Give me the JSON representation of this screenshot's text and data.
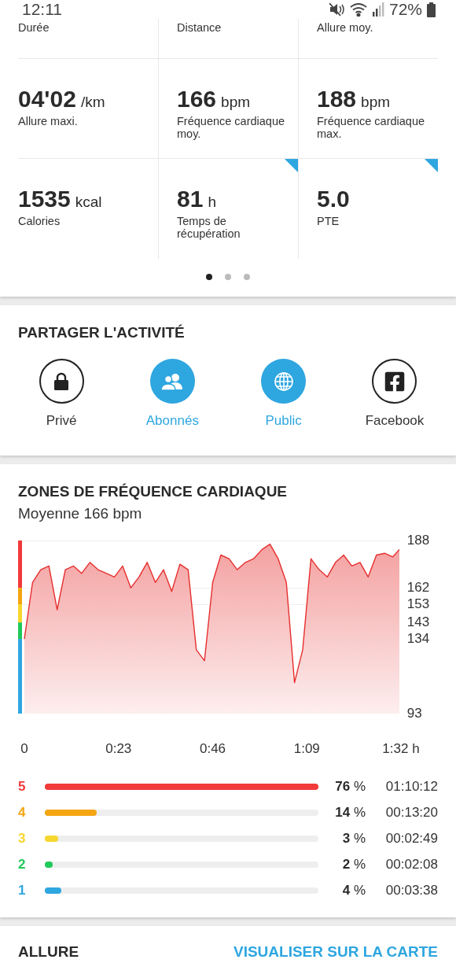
{
  "status_bar": {
    "time": "12:11",
    "battery": "72%"
  },
  "stats": {
    "rows": [
      [
        {
          "label": "Durée",
          "flagged": false
        },
        {
          "label": "Distance",
          "flagged": false
        },
        {
          "label": "Allure moy.",
          "flagged": false
        }
      ],
      [
        {
          "value": "04'02",
          "unit": "/km",
          "label": "Allure maxi.",
          "flagged": false
        },
        {
          "value": "166",
          "unit": "bpm",
          "label": "Fréquence cardiaque moy.",
          "flagged": false
        },
        {
          "value": "188",
          "unit": "bpm",
          "label": "Fréquence cardiaque max.",
          "flagged": false
        }
      ],
      [
        {
          "value": "1535",
          "unit": "kcal",
          "label": "Calories",
          "flagged": false
        },
        {
          "value": "81",
          "unit": "h",
          "label": "Temps de récupération",
          "flagged": true
        },
        {
          "value": "5.0",
          "label": "PTE",
          "flagged": true
        }
      ]
    ],
    "pages": [
      {
        "selected": true
      },
      {
        "selected": false
      },
      {
        "selected": false
      }
    ]
  },
  "share": {
    "title": "PARTAGER L'ACTIVITÉ",
    "options": [
      {
        "kind": "lock",
        "label": "Privé",
        "selected": false
      },
      {
        "kind": "people",
        "label": "Abonnés",
        "selected": true
      },
      {
        "kind": "globe",
        "label": "Public",
        "selected": true
      },
      {
        "kind": "facebook",
        "label": "Facebook",
        "selected": false
      }
    ]
  },
  "heart_rate": {
    "title": "ZONES DE FRÉQUENCE CARDIAQUE",
    "subtitle": "Moyenne 166 bpm",
    "chart_data": {
      "type": "area",
      "x": [
        0,
        2,
        4,
        6,
        8,
        10,
        12,
        14,
        16,
        18,
        20,
        22,
        24,
        26,
        28,
        30,
        32,
        34,
        36,
        38,
        40,
        42,
        44,
        46,
        48,
        50,
        52,
        54,
        56,
        58,
        60,
        62,
        64,
        66,
        68,
        70,
        72,
        74,
        76,
        78,
        80,
        82,
        84,
        86,
        88,
        90,
        92
      ],
      "series": [
        {
          "color": "#e62e2e",
          "values": [
            134,
            165,
            172,
            174,
            150,
            172,
            174,
            170,
            176,
            172,
            170,
            168,
            174,
            162,
            168,
            176,
            165,
            172,
            160,
            175,
            172,
            128,
            122,
            165,
            180,
            178,
            172,
            176,
            178,
            183,
            186,
            178,
            165,
            110,
            128,
            178,
            172,
            168,
            176,
            180,
            174,
            176,
            168,
            180,
            181,
            179,
            184
          ]
        }
      ],
      "xlim": [
        0,
        92
      ],
      "ylim": [
        93,
        188
      ],
      "xticks": [
        {
          "value": 0,
          "label": "0"
        },
        {
          "value": 23,
          "label": "0:23"
        },
        {
          "value": 46,
          "label": "0:46"
        },
        {
          "value": 69,
          "label": "1:09"
        },
        {
          "value": 92,
          "label": "1:32 h"
        }
      ],
      "yticks": [
        188,
        162,
        153,
        143,
        134,
        93
      ]
    },
    "zones": [
      {
        "zone": "5",
        "color": "#f23a3a",
        "level": 1,
        "percent": "**76** %",
        "time": "01:10:12"
      },
      {
        "zone": "4",
        "color": "#f5a511",
        "level": 0.19,
        "percent": "**14** %",
        "time": "00:13:20"
      },
      {
        "zone": "3",
        "color": "#f7d62e",
        "level": 0.05,
        "percent": "**3** %",
        "time": "00:02:49"
      },
      {
        "zone": "2",
        "color": "#1fc95a",
        "level": 0.03,
        "percent": "**2** %",
        "time": "00:02:08"
      },
      {
        "zone": "1",
        "color": "#2ea6e0",
        "level": 0.06,
        "percent": "**4** %",
        "time": "00:03:38"
      }
    ]
  },
  "next_section": {
    "title": "ALLURE",
    "link": "VISUALISER SUR LA CARTE"
  }
}
